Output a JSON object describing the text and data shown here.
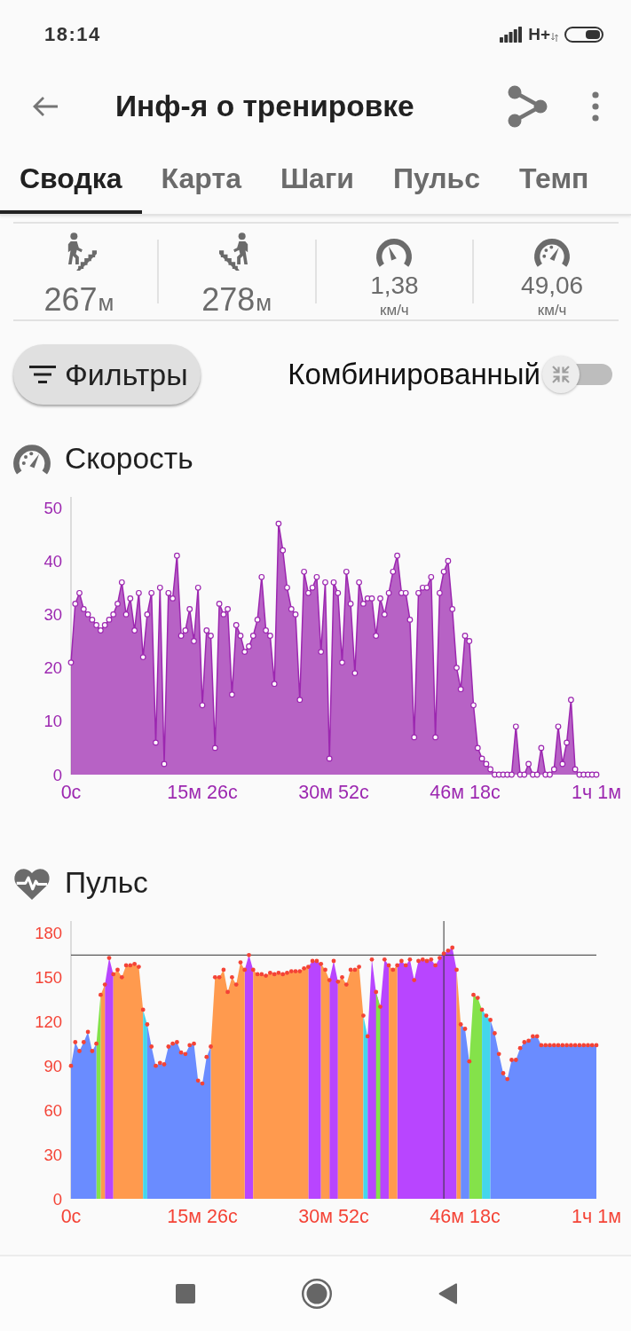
{
  "status_bar": {
    "time": "18:14",
    "network": "H+"
  },
  "app_bar": {
    "title": "Инф-я о тренировке"
  },
  "tabs": [
    {
      "label": "Сводка",
      "selected": true
    },
    {
      "label": "Карта",
      "selected": false
    },
    {
      "label": "Шаги",
      "selected": false
    },
    {
      "label": "Пульс",
      "selected": false
    },
    {
      "label": "Темп",
      "selected": false
    }
  ],
  "stats": [
    {
      "kind": "ascent",
      "value": "267",
      "unit": "м"
    },
    {
      "kind": "descent",
      "value": "278",
      "unit": "м"
    },
    {
      "kind": "avg_speed",
      "value": "1,38",
      "unit": "км/ч"
    },
    {
      "kind": "max_speed",
      "value": "49,06",
      "unit": "км/ч"
    }
  ],
  "filters_button": {
    "label": "Фильтры"
  },
  "combined_switch": {
    "label": "Комбинированный",
    "on": false
  },
  "sections": [
    {
      "kind": "speed",
      "title": "Скорость",
      "chart_data": {
        "type": "area",
        "categories": [
          "0с",
          null,
          null,
          null,
          null,
          null,
          null,
          null,
          null,
          null,
          null,
          null,
          null,
          null,
          null,
          null,
          null,
          null,
          null,
          null,
          null,
          null,
          null,
          null,
          null,
          null,
          null,
          null,
          null,
          null,
          null,
          "15м 26с",
          null,
          null,
          null,
          null,
          null,
          null,
          null,
          null,
          null,
          null,
          null,
          null,
          null,
          null,
          null,
          null,
          null,
          null,
          null,
          null,
          null,
          null,
          null,
          null,
          null,
          null,
          null,
          null,
          null,
          null,
          "30м 52с",
          null,
          null,
          null,
          null,
          null,
          null,
          null,
          null,
          null,
          null,
          null,
          null,
          null,
          null,
          null,
          null,
          null,
          null,
          null,
          null,
          null,
          null,
          null,
          null,
          null,
          null,
          null,
          null,
          null,
          null,
          "46м 18с",
          null,
          null,
          null,
          null,
          null,
          null,
          null,
          null,
          null,
          null,
          null,
          null,
          null,
          null,
          null,
          null,
          null,
          null,
          null,
          null,
          null,
          null,
          null,
          null,
          null,
          null,
          null,
          null,
          null,
          null,
          "1ч 1м"
        ],
        "series": [
          {
            "color": "#9c27b0",
            "values": [
              21,
              32,
              34,
              31,
              30,
              29,
              28,
              27,
              28,
              29,
              30,
              32,
              36,
              30,
              33,
              27,
              34,
              22,
              30,
              34,
              6,
              35,
              2,
              34,
              33,
              41,
              26,
              27,
              31,
              25,
              35,
              13,
              27,
              26,
              5,
              32,
              30,
              31,
              15,
              28,
              26,
              23,
              24,
              26,
              29,
              37,
              27,
              26,
              17,
              47,
              42,
              35,
              31,
              30,
              14,
              38,
              34,
              35,
              37,
              23,
              36,
              3,
              36,
              34,
              21,
              38,
              32,
              19,
              36,
              32,
              33,
              33,
              26,
              33,
              30,
              34,
              38,
              41,
              34,
              34,
              29,
              7,
              34,
              35,
              35,
              37,
              7,
              34,
              38,
              40,
              31,
              20,
              16,
              26,
              25,
              13,
              5,
              3,
              2,
              1,
              0,
              0,
              0,
              0,
              0,
              9,
              0,
              0,
              2,
              0,
              0,
              5,
              0,
              0,
              1,
              9,
              2,
              6,
              14,
              1,
              0,
              0,
              0,
              0,
              0
            ]
          }
        ],
        "ylim": [
          0,
          52
        ],
        "yticks": [
          0,
          10,
          20,
          30,
          40,
          50
        ]
      }
    },
    {
      "kind": "heart_rate",
      "title": "Пульс",
      "chart_data": {
        "type": "area",
        "categories": [
          "0с",
          null,
          null,
          null,
          null,
          null,
          null,
          null,
          null,
          null,
          null,
          null,
          null,
          null,
          null,
          null,
          null,
          null,
          null,
          null,
          null,
          null,
          null,
          null,
          null,
          null,
          null,
          null,
          null,
          null,
          null,
          "15м 26с",
          null,
          null,
          null,
          null,
          null,
          null,
          null,
          null,
          null,
          null,
          null,
          null,
          null,
          null,
          null,
          null,
          null,
          null,
          null,
          null,
          null,
          null,
          null,
          null,
          null,
          null,
          null,
          null,
          null,
          null,
          "30м 52с",
          null,
          null,
          null,
          null,
          null,
          null,
          null,
          null,
          null,
          null,
          null,
          null,
          null,
          null,
          null,
          null,
          null,
          null,
          null,
          null,
          null,
          null,
          null,
          null,
          null,
          null,
          null,
          null,
          null,
          null,
          "46м 18с",
          null,
          null,
          null,
          null,
          null,
          null,
          null,
          null,
          null,
          null,
          null,
          null,
          null,
          null,
          null,
          null,
          null,
          null,
          null,
          null,
          null,
          null,
          null,
          null,
          null,
          null,
          null,
          null,
          null,
          null,
          "1ч 1м"
        ],
        "series": [
          {
            "color": "#b845ff",
            "values": [
              null,
              null,
              null,
              null,
              null,
              null,
              null,
              null,
              145,
              163,
              152,
              null,
              null,
              null,
              null,
              null,
              null,
              null,
              null,
              null,
              null,
              null,
              null,
              null,
              null,
              null,
              null,
              null,
              null,
              null,
              null,
              null,
              null,
              null,
              null,
              null,
              null,
              null,
              null,
              null,
              null,
              155,
              165,
              155,
              null,
              null,
              null,
              null,
              null,
              null,
              null,
              null,
              null,
              null,
              null,
              null,
              157,
              161,
              161,
              159,
              null,
              148,
              161,
              147,
              null,
              null,
              null,
              null,
              null,
              null,
              110,
              162,
              140,
              130,
              162,
              158,
              null,
              158,
              161,
              158,
              162,
              148,
              161,
              162,
              161,
              162,
              158,
              163,
              166,
              168,
              170,
              155,
              null,
              null,
              null,
              null,
              null,
              null,
              null,
              null,
              null,
              null,
              null,
              null,
              null,
              null,
              null,
              null,
              null,
              null,
              null,
              null,
              null,
              null,
              null,
              null,
              null,
              null,
              null,
              null,
              null,
              null,
              null,
              null,
              null
            ]
          },
          {
            "color": "#ff9a4e",
            "values": [
              null,
              null,
              null,
              null,
              null,
              null,
              null,
              138,
              145,
              null,
              152,
              155,
              150,
              158,
              158,
              159,
              157,
              128,
              null,
              null,
              null,
              null,
              null,
              null,
              null,
              null,
              null,
              null,
              null,
              null,
              null,
              null,
              null,
              103,
              150,
              150,
              155,
              140,
              150,
              145,
              160,
              155,
              null,
              155,
              152,
              152,
              151,
              153,
              152,
              153,
              152,
              153,
              154,
              154,
              154,
              156,
              157,
              null,
              null,
              159,
              155,
              148,
              null,
              147,
              150,
              145,
              155,
              155,
              157,
              124,
              null,
              null,
              null,
              null,
              null,
              158,
              155,
              158,
              null,
              null,
              null,
              null,
              null,
              null,
              null,
              null,
              null,
              null,
              null,
              null,
              null,
              155,
              118,
              null,
              null,
              null,
              null,
              null,
              null,
              null,
              null,
              null,
              null,
              null,
              null,
              null,
              null,
              null,
              null,
              null,
              null,
              null,
              null,
              null,
              null,
              null,
              null,
              null,
              null,
              null,
              null,
              null,
              null,
              null,
              null
            ]
          },
          {
            "color": "#84e24a",
            "values": [
              null,
              null,
              null,
              null,
              null,
              null,
              105,
              138,
              null,
              null,
              null,
              null,
              null,
              null,
              null,
              null,
              null,
              null,
              null,
              null,
              null,
              null,
              null,
              null,
              null,
              null,
              null,
              null,
              null,
              null,
              null,
              null,
              null,
              null,
              null,
              null,
              null,
              null,
              null,
              null,
              null,
              null,
              null,
              null,
              null,
              null,
              null,
              null,
              null,
              null,
              null,
              null,
              null,
              null,
              null,
              null,
              null,
              null,
              null,
              null,
              null,
              null,
              null,
              null,
              null,
              null,
              null,
              null,
              null,
              null,
              null,
              null,
              140,
              130,
              null,
              null,
              null,
              null,
              null,
              null,
              null,
              null,
              null,
              null,
              null,
              null,
              null,
              null,
              null,
              null,
              null,
              null,
              null,
              null,
              93,
              138,
              136,
              128,
              null,
              null,
              null,
              null,
              null,
              null,
              null,
              null,
              null,
              null,
              null,
              null,
              null,
              null,
              null,
              null,
              null,
              null,
              null,
              null,
              null,
              null,
              null,
              null,
              null,
              null,
              null
            ]
          },
          {
            "color": "#44d6ec",
            "values": [
              null,
              null,
              null,
              null,
              null,
              null,
              null,
              null,
              null,
              null,
              null,
              null,
              null,
              null,
              null,
              null,
              null,
              128,
              118,
              null,
              null,
              null,
              null,
              null,
              null,
              null,
              null,
              null,
              null,
              null,
              null,
              null,
              null,
              null,
              null,
              null,
              null,
              null,
              null,
              null,
              null,
              null,
              null,
              null,
              null,
              null,
              null,
              null,
              null,
              null,
              null,
              null,
              null,
              null,
              null,
              null,
              null,
              null,
              null,
              null,
              null,
              null,
              null,
              null,
              null,
              null,
              null,
              null,
              null,
              124,
              110,
              null,
              null,
              null,
              null,
              null,
              null,
              null,
              null,
              null,
              null,
              null,
              null,
              null,
              null,
              null,
              null,
              null,
              null,
              null,
              null,
              null,
              null,
              null,
              null,
              null,
              null,
              128,
              124,
              121,
              null,
              null,
              null,
              null,
              null,
              null,
              null,
              null,
              null,
              null,
              null,
              null,
              null,
              null,
              null,
              null,
              null,
              null,
              null,
              null,
              null,
              null,
              null,
              null,
              null
            ]
          },
          {
            "color": "#6a8cff",
            "values": [
              90,
              106,
              100,
              106,
              113,
              100,
              105,
              null,
              null,
              null,
              null,
              null,
              null,
              null,
              null,
              null,
              null,
              null,
              118,
              103,
              90,
              92,
              91,
              103,
              105,
              106,
              99,
              98,
              104,
              105,
              80,
              78,
              96,
              103,
              null,
              null,
              null,
              null,
              null,
              null,
              null,
              null,
              null,
              null,
              null,
              null,
              null,
              null,
              null,
              null,
              null,
              null,
              null,
              null,
              null,
              null,
              null,
              null,
              null,
              null,
              null,
              null,
              null,
              null,
              null,
              null,
              null,
              null,
              null,
              null,
              null,
              null,
              null,
              null,
              null,
              null,
              null,
              null,
              null,
              null,
              null,
              null,
              null,
              null,
              null,
              null,
              null,
              null,
              null,
              null,
              null,
              null,
              118,
              115,
              93,
              null,
              null,
              null,
              null,
              121,
              112,
              98,
              85,
              81,
              94,
              94,
              102,
              106,
              107,
              110,
              110,
              104,
              104,
              104,
              104,
              104,
              104,
              104,
              104,
              104,
              104,
              104,
              104,
              104,
              104
            ]
          }
        ],
        "ylim": [
          0,
          188
        ],
        "yticks": [
          0,
          30,
          60,
          90,
          120,
          150,
          180
        ],
        "ref_lines": [
          {
            "axis": "y",
            "value": 165
          }
        ]
      }
    }
  ]
}
